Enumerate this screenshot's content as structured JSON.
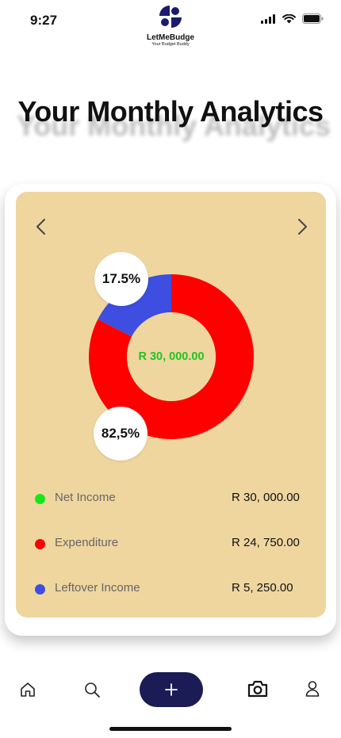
{
  "status": {
    "time": "9:27"
  },
  "app": {
    "name": "LetMeBudge",
    "tagline": "Your Budget Buddy"
  },
  "page": {
    "title": "Your Monthly Analytics"
  },
  "chart_data": {
    "type": "pie",
    "donut": true,
    "center_label": "R 30, 000.00",
    "slices": [
      {
        "label": "Expenditure",
        "percent_label": "82,5%",
        "value": 82.5,
        "color": "#ff0000"
      },
      {
        "label": "Leftover Income",
        "percent_label": "17.5%",
        "value": 17.5,
        "color": "#3d4ee0"
      }
    ]
  },
  "legend": [
    {
      "label": "Net Income",
      "value": "R 30, 000.00",
      "color": "#19e619"
    },
    {
      "label": "Expenditure",
      "value": "R 24, 750.00",
      "color": "#ff0000"
    },
    {
      "label": "Leftover Income",
      "value": "R 5, 250.00",
      "color": "#3d4ee0"
    }
  ],
  "nav": {
    "items": [
      {
        "icon": "home-icon"
      },
      {
        "icon": "search-icon"
      },
      {
        "icon": "plus-icon"
      },
      {
        "icon": "camera-icon"
      },
      {
        "icon": "user-icon"
      }
    ]
  }
}
